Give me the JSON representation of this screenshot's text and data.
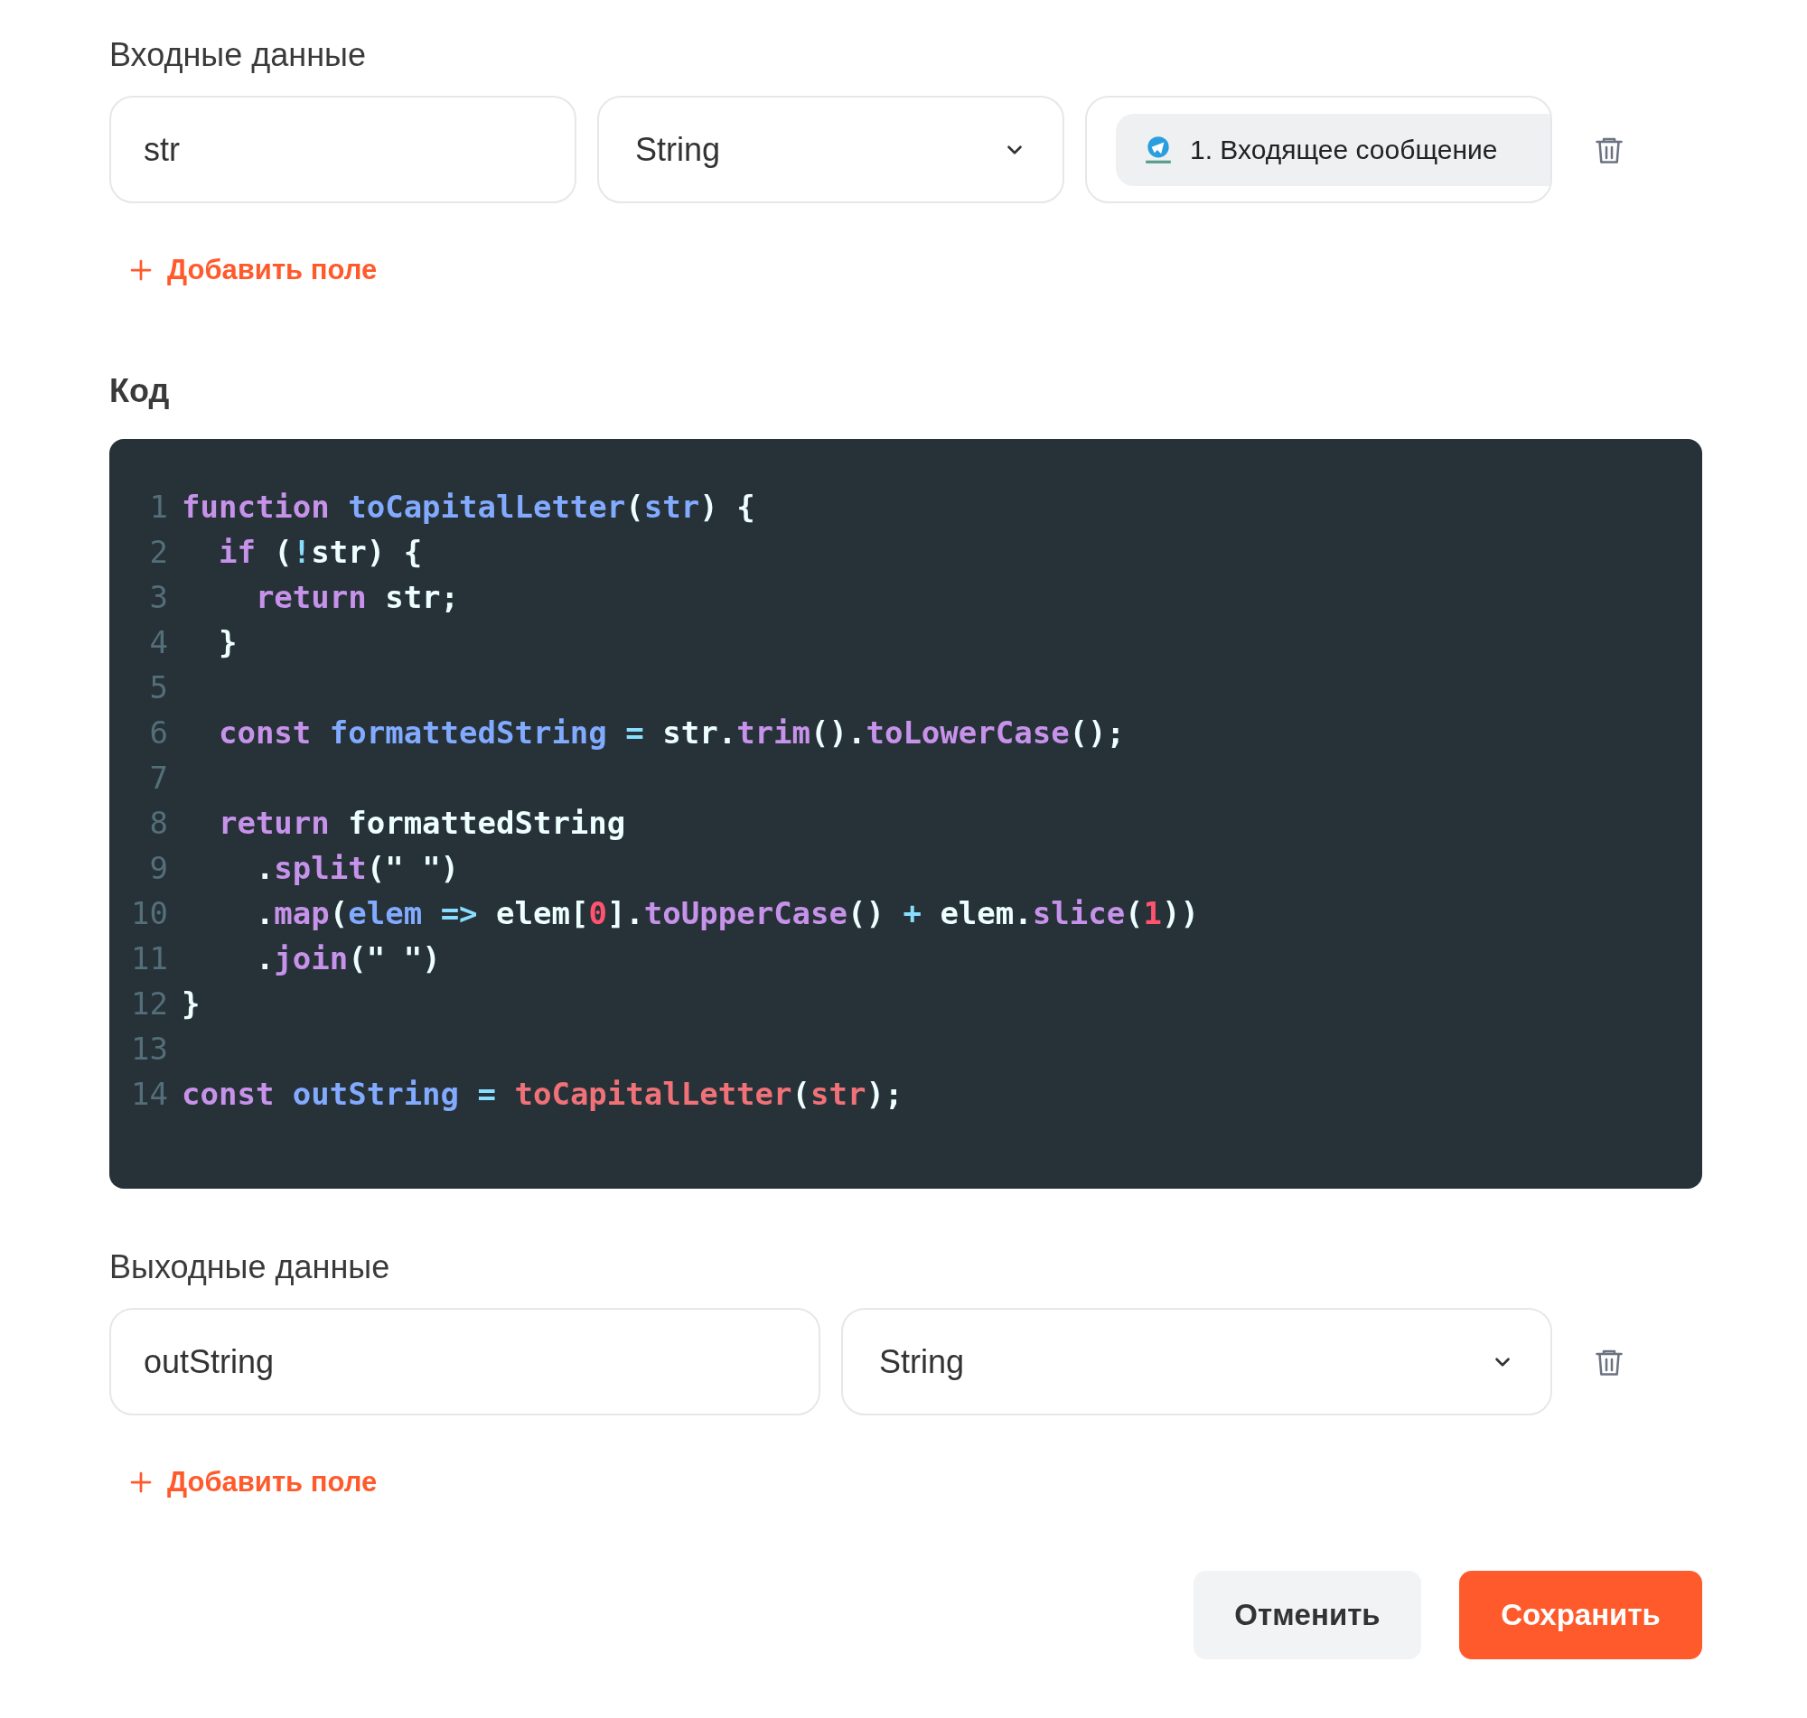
{
  "inputs": {
    "title": "Входные данные",
    "fields": [
      {
        "name": "str",
        "type": "String",
        "source": "1. Входящее сообщение"
      }
    ],
    "add_button": "Добавить поле"
  },
  "code": {
    "title": "Код",
    "lines": [
      {
        "number": "1",
        "tokens": [
          {
            "kind": "keyword",
            "text": "function "
          },
          {
            "kind": "definition",
            "text": "toCapitalLetter"
          },
          {
            "kind": "text",
            "text": "("
          },
          {
            "kind": "definition",
            "text": "str"
          },
          {
            "kind": "text",
            "text": ") {"
          }
        ]
      },
      {
        "number": "2",
        "tokens": [
          {
            "kind": "keyword",
            "text": "  if"
          },
          {
            "kind": "text",
            "text": " ("
          },
          {
            "kind": "operator",
            "text": "!"
          },
          {
            "kind": "text",
            "text": "str) {"
          }
        ]
      },
      {
        "number": "3",
        "tokens": [
          {
            "kind": "keyword",
            "text": "    return"
          },
          {
            "kind": "text",
            "text": " str;"
          }
        ]
      },
      {
        "number": "4",
        "tokens": [
          {
            "kind": "text",
            "text": "  }"
          }
        ]
      },
      {
        "number": "5"
      },
      {
        "number": "6",
        "tokens": [
          {
            "kind": "keyword",
            "text": "  const "
          },
          {
            "kind": "definition",
            "text": "formattedString"
          },
          {
            "kind": "operator",
            "text": " = "
          },
          {
            "kind": "text",
            "text": "str."
          },
          {
            "kind": "method",
            "text": "trim"
          },
          {
            "kind": "text",
            "text": "()."
          },
          {
            "kind": "method",
            "text": "toLowerCase"
          },
          {
            "kind": "text",
            "text": "();"
          }
        ]
      },
      {
        "number": "7"
      },
      {
        "number": "8",
        "tokens": [
          {
            "kind": "keyword",
            "text": "  return"
          },
          {
            "kind": "text",
            "text": " formattedString"
          }
        ]
      },
      {
        "number": "9",
        "tokens": [
          {
            "kind": "text",
            "text": "    ."
          },
          {
            "kind": "method",
            "text": "split"
          },
          {
            "kind": "text",
            "text": "(\" \")"
          }
        ]
      },
      {
        "number": "10",
        "tokens": [
          {
            "kind": "text",
            "text": "    ."
          },
          {
            "kind": "method",
            "text": "map"
          },
          {
            "kind": "text",
            "text": "("
          },
          {
            "kind": "definition",
            "text": "elem"
          },
          {
            "kind": "operator",
            "text": " => "
          },
          {
            "kind": "text",
            "text": "elem["
          },
          {
            "kind": "number",
            "text": "0"
          },
          {
            "kind": "text",
            "text": "]."
          },
          {
            "kind": "method",
            "text": "toUpperCase"
          },
          {
            "kind": "text",
            "text": "()"
          },
          {
            "kind": "operator",
            "text": " + "
          },
          {
            "kind": "text",
            "text": "elem."
          },
          {
            "kind": "method",
            "text": "slice"
          },
          {
            "kind": "text",
            "text": "("
          },
          {
            "kind": "number",
            "text": "1"
          },
          {
            "kind": "text",
            "text": "))"
          }
        ]
      },
      {
        "number": "11",
        "tokens": [
          {
            "kind": "text",
            "text": "    ."
          },
          {
            "kind": "method",
            "text": "join"
          },
          {
            "kind": "text",
            "text": "(\" \")"
          }
        ]
      },
      {
        "number": "12",
        "tokens": [
          {
            "kind": "text",
            "text": "}"
          }
        ]
      },
      {
        "number": "13"
      },
      {
        "number": "14",
        "tokens": [
          {
            "kind": "keyword",
            "text": "const "
          },
          {
            "kind": "definition",
            "text": "outString"
          },
          {
            "kind": "operator",
            "text": " = "
          },
          {
            "kind": "call",
            "text": "toCapitalLetter"
          },
          {
            "kind": "text",
            "text": "("
          },
          {
            "kind": "call",
            "text": "str"
          },
          {
            "kind": "text",
            "text": ");"
          }
        ]
      }
    ]
  },
  "outputs": {
    "title": "Выходные данные",
    "fields": [
      {
        "name": "outString",
        "type": "String"
      }
    ],
    "add_button": "Добавить поле"
  },
  "buttons": {
    "cancel": "Отменить",
    "save": "Сохранить"
  }
}
